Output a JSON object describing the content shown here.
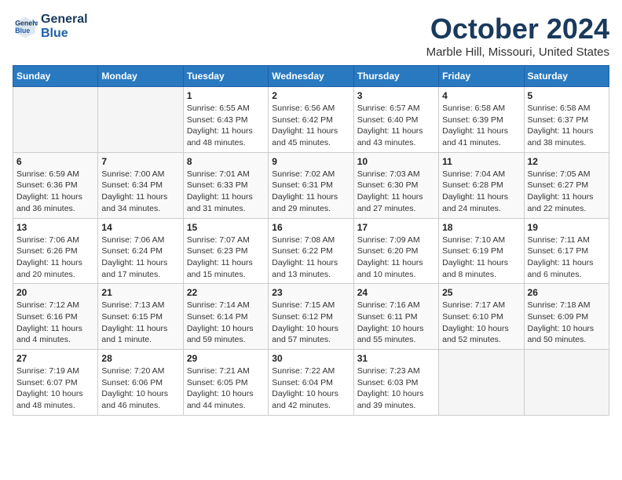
{
  "logo": {
    "line1": "General",
    "line2": "Blue"
  },
  "title": "October 2024",
  "subtitle": "Marble Hill, Missouri, United States",
  "weekdays": [
    "Sunday",
    "Monday",
    "Tuesday",
    "Wednesday",
    "Thursday",
    "Friday",
    "Saturday"
  ],
  "weeks": [
    [
      {
        "day": "",
        "info": ""
      },
      {
        "day": "",
        "info": ""
      },
      {
        "day": "1",
        "info": "Sunrise: 6:55 AM\nSunset: 6:43 PM\nDaylight: 11 hours and 48 minutes."
      },
      {
        "day": "2",
        "info": "Sunrise: 6:56 AM\nSunset: 6:42 PM\nDaylight: 11 hours and 45 minutes."
      },
      {
        "day": "3",
        "info": "Sunrise: 6:57 AM\nSunset: 6:40 PM\nDaylight: 11 hours and 43 minutes."
      },
      {
        "day": "4",
        "info": "Sunrise: 6:58 AM\nSunset: 6:39 PM\nDaylight: 11 hours and 41 minutes."
      },
      {
        "day": "5",
        "info": "Sunrise: 6:58 AM\nSunset: 6:37 PM\nDaylight: 11 hours and 38 minutes."
      }
    ],
    [
      {
        "day": "6",
        "info": "Sunrise: 6:59 AM\nSunset: 6:36 PM\nDaylight: 11 hours and 36 minutes."
      },
      {
        "day": "7",
        "info": "Sunrise: 7:00 AM\nSunset: 6:34 PM\nDaylight: 11 hours and 34 minutes."
      },
      {
        "day": "8",
        "info": "Sunrise: 7:01 AM\nSunset: 6:33 PM\nDaylight: 11 hours and 31 minutes."
      },
      {
        "day": "9",
        "info": "Sunrise: 7:02 AM\nSunset: 6:31 PM\nDaylight: 11 hours and 29 minutes."
      },
      {
        "day": "10",
        "info": "Sunrise: 7:03 AM\nSunset: 6:30 PM\nDaylight: 11 hours and 27 minutes."
      },
      {
        "day": "11",
        "info": "Sunrise: 7:04 AM\nSunset: 6:28 PM\nDaylight: 11 hours and 24 minutes."
      },
      {
        "day": "12",
        "info": "Sunrise: 7:05 AM\nSunset: 6:27 PM\nDaylight: 11 hours and 22 minutes."
      }
    ],
    [
      {
        "day": "13",
        "info": "Sunrise: 7:06 AM\nSunset: 6:26 PM\nDaylight: 11 hours and 20 minutes."
      },
      {
        "day": "14",
        "info": "Sunrise: 7:06 AM\nSunset: 6:24 PM\nDaylight: 11 hours and 17 minutes."
      },
      {
        "day": "15",
        "info": "Sunrise: 7:07 AM\nSunset: 6:23 PM\nDaylight: 11 hours and 15 minutes."
      },
      {
        "day": "16",
        "info": "Sunrise: 7:08 AM\nSunset: 6:22 PM\nDaylight: 11 hours and 13 minutes."
      },
      {
        "day": "17",
        "info": "Sunrise: 7:09 AM\nSunset: 6:20 PM\nDaylight: 11 hours and 10 minutes."
      },
      {
        "day": "18",
        "info": "Sunrise: 7:10 AM\nSunset: 6:19 PM\nDaylight: 11 hours and 8 minutes."
      },
      {
        "day": "19",
        "info": "Sunrise: 7:11 AM\nSunset: 6:17 PM\nDaylight: 11 hours and 6 minutes."
      }
    ],
    [
      {
        "day": "20",
        "info": "Sunrise: 7:12 AM\nSunset: 6:16 PM\nDaylight: 11 hours and 4 minutes."
      },
      {
        "day": "21",
        "info": "Sunrise: 7:13 AM\nSunset: 6:15 PM\nDaylight: 11 hours and 1 minute."
      },
      {
        "day": "22",
        "info": "Sunrise: 7:14 AM\nSunset: 6:14 PM\nDaylight: 10 hours and 59 minutes."
      },
      {
        "day": "23",
        "info": "Sunrise: 7:15 AM\nSunset: 6:12 PM\nDaylight: 10 hours and 57 minutes."
      },
      {
        "day": "24",
        "info": "Sunrise: 7:16 AM\nSunset: 6:11 PM\nDaylight: 10 hours and 55 minutes."
      },
      {
        "day": "25",
        "info": "Sunrise: 7:17 AM\nSunset: 6:10 PM\nDaylight: 10 hours and 52 minutes."
      },
      {
        "day": "26",
        "info": "Sunrise: 7:18 AM\nSunset: 6:09 PM\nDaylight: 10 hours and 50 minutes."
      }
    ],
    [
      {
        "day": "27",
        "info": "Sunrise: 7:19 AM\nSunset: 6:07 PM\nDaylight: 10 hours and 48 minutes."
      },
      {
        "day": "28",
        "info": "Sunrise: 7:20 AM\nSunset: 6:06 PM\nDaylight: 10 hours and 46 minutes."
      },
      {
        "day": "29",
        "info": "Sunrise: 7:21 AM\nSunset: 6:05 PM\nDaylight: 10 hours and 44 minutes."
      },
      {
        "day": "30",
        "info": "Sunrise: 7:22 AM\nSunset: 6:04 PM\nDaylight: 10 hours and 42 minutes."
      },
      {
        "day": "31",
        "info": "Sunrise: 7:23 AM\nSunset: 6:03 PM\nDaylight: 10 hours and 39 minutes."
      },
      {
        "day": "",
        "info": ""
      },
      {
        "day": "",
        "info": ""
      }
    ]
  ]
}
